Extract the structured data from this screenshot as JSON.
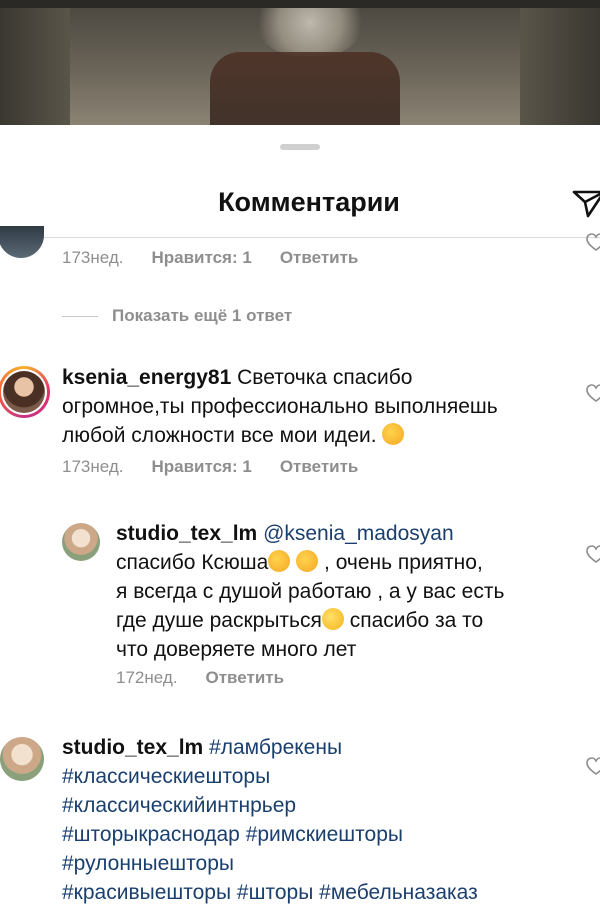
{
  "header": {
    "title": "Комментарии"
  },
  "icons": {
    "share": "paper-plane-icon",
    "like": "heart-icon"
  },
  "prev_comment": {
    "time": "173нед.",
    "likes": "Нравится: 1",
    "reply": "Ответить"
  },
  "show_more": "Показать ещё 1 ответ",
  "comment1": {
    "username": "ksenia_energy81",
    "lines": [
      "Светочка спасибо",
      "огромное,ты профессионально выполняешь",
      "любой сложности все мои идеи."
    ],
    "time": "173нед.",
    "likes": "Нравится: 1",
    "reply": "Ответить"
  },
  "reply1": {
    "username": "studio_tex_lm",
    "mention": "@ksenia_madosyan",
    "line2": "спасибо Ксюша",
    "line2b": " , очень приятно,",
    "line3": "я всегда с душой работаю , а у вас есть",
    "line4a": "где душе раскрыться",
    "line4b": " спасибо за то",
    "line5": "что доверяете много лет",
    "time": "172нед.",
    "reply": "Ответить"
  },
  "comment2": {
    "username": "studio_tex_lm",
    "tag1": "#ламбрекены",
    "tag2": "#классическиешторы",
    "tag3": "#классическийинтнрьер",
    "tag4": "#шторыкраснодар",
    "tag5": "#римскиешторы",
    "tag6": "#рулонныешторы",
    "tag7": "#красивыешторы",
    "tag8": "#шторы",
    "tag9": "#мебельназаказ"
  },
  "colors": {
    "link": "#1a3f6e",
    "meta": "#8e8e8e",
    "divider": "#dbdbdb"
  }
}
